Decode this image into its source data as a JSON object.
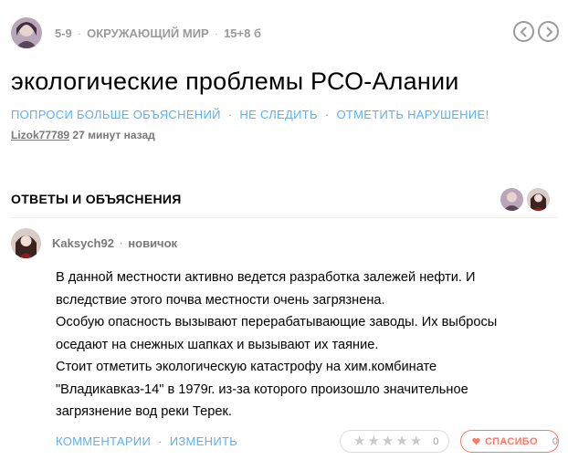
{
  "question": {
    "grade": "5-9",
    "subject": "ОКРУЖАЮЩИЙ МИР",
    "points": "15+8 б",
    "title": "экологические проблемы РСО-Алании",
    "actions": {
      "more_explanations": "ПОПРОСИ БОЛЬШЕ ОБЪЯСНЕНИЙ",
      "unfollow": "НЕ СЛЕДИТЬ",
      "report": "ОТМЕТИТЬ НАРУШЕНИЕ!"
    },
    "author": "Lizok77789",
    "time": "27 минут назад"
  },
  "answers_section": {
    "heading": "ОТВЕТЫ И ОБЪЯСНЕНИЯ"
  },
  "answer": {
    "user": "Kaksych92",
    "rank": "новичок",
    "lines": [
      "В данной местности активно ведется разработка залежей нефти. И",
      "вследствие этого почва местности очень загрязнена.",
      "Особую опасность вызывают перерабатывающие заводы. Их выбросы",
      "оседают на снежных шапках и вызывают их таяние.",
      "Стоит отметить экологическую катастрофу на хим.комбинате",
      "\"Владикавказ-14\" в 1979г. из-за которого произошло значительное",
      "загрязнение вод реки Терек."
    ],
    "comments_label": "КОММЕНТАРИИ",
    "edit_label": "ИЗМЕНИТЬ",
    "rating_count": "0",
    "thanks_label": "СПАСИБО",
    "thanks_count": "0"
  },
  "colors": {
    "accent": "#57b2f8",
    "muted": "#9a9a9a",
    "thanks": "#ff7968"
  },
  "icons": [
    "chevron-left-icon",
    "chevron-right-icon",
    "star-icon",
    "heart-icon"
  ]
}
